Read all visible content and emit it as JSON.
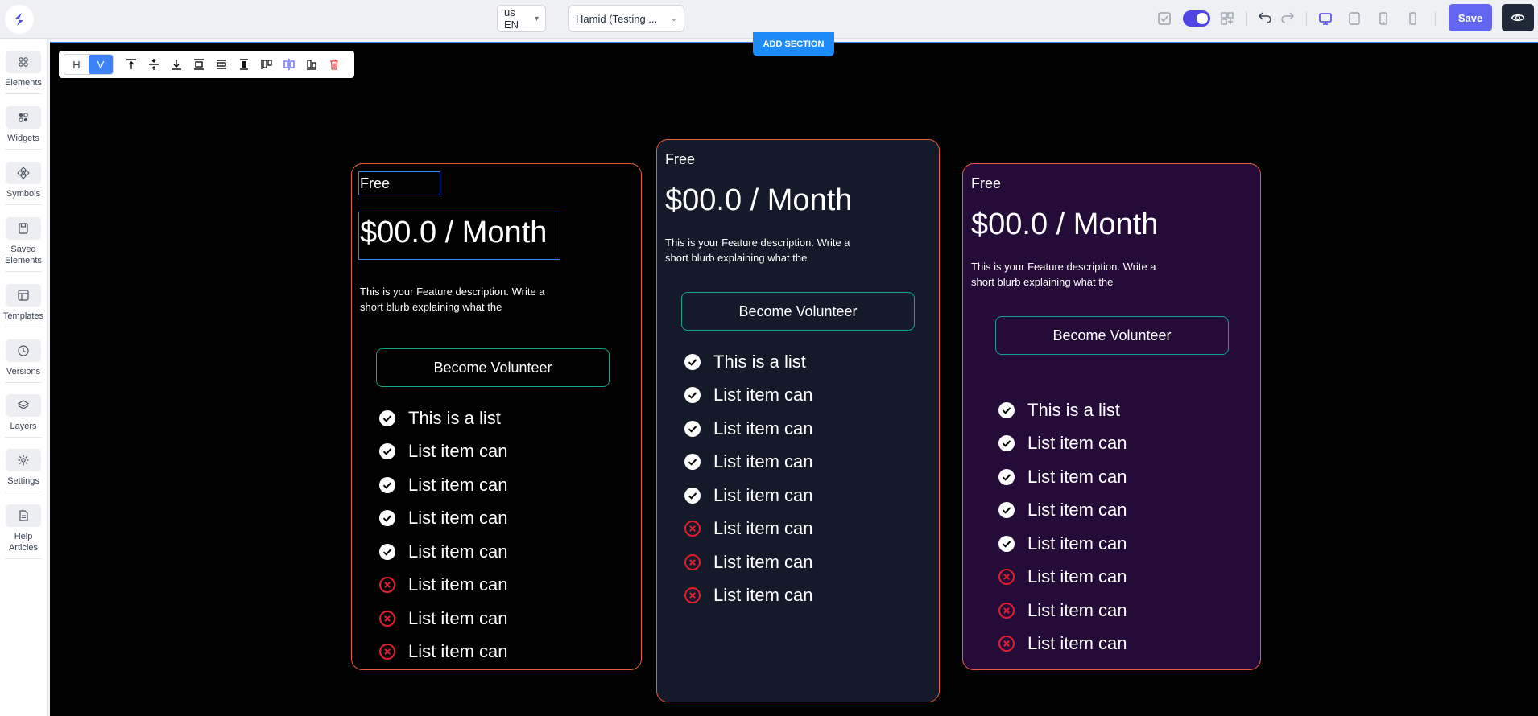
{
  "header": {
    "language": "us EN",
    "user_select": "Hamid (Testing ...",
    "save_label": "Save"
  },
  "add_section_label": "ADD SECTION",
  "toolbar": {
    "h_label": "H",
    "v_label": "V"
  },
  "sidebar": {
    "items": [
      {
        "label": "Elements",
        "icon": "elements-icon"
      },
      {
        "label": "Widgets",
        "icon": "widgets-icon"
      },
      {
        "label": "Symbols",
        "icon": "symbols-icon"
      },
      {
        "label": "Saved Elements",
        "icon": "saved-elements-icon"
      },
      {
        "label": "Templates",
        "icon": "templates-icon"
      },
      {
        "label": "Versions",
        "icon": "versions-icon"
      },
      {
        "label": "Layers",
        "icon": "layers-icon"
      },
      {
        "label": "Settings",
        "icon": "settings-icon"
      },
      {
        "label": "Help Articles",
        "icon": "help-articles-icon"
      }
    ]
  },
  "cards": [
    {
      "plan": "Free",
      "price": "$00.0 / Month",
      "description": "This is your Feature description. Write a short blurb explaining what the",
      "cta": "Become Volunteer",
      "background": "#000000",
      "list": [
        {
          "text": "This is a list",
          "included": true
        },
        {
          "text": "List item can",
          "included": true
        },
        {
          "text": "List item can",
          "included": true
        },
        {
          "text": "List item can",
          "included": true
        },
        {
          "text": "List item can",
          "included": true
        },
        {
          "text": "List item can",
          "included": false
        },
        {
          "text": "List item can",
          "included": false
        },
        {
          "text": "List item can",
          "included": false
        }
      ]
    },
    {
      "plan": "Free",
      "price": "$00.0 / Month",
      "description": "This is your Feature description. Write a short blurb explaining what the",
      "cta": "Become Volunteer",
      "background": "#151a2b",
      "list": [
        {
          "text": "This is a list",
          "included": true
        },
        {
          "text": "List item can",
          "included": true
        },
        {
          "text": "List item can",
          "included": true
        },
        {
          "text": "List item can",
          "included": true
        },
        {
          "text": "List item can",
          "included": true
        },
        {
          "text": "List item can",
          "included": false
        },
        {
          "text": "List item can",
          "included": false
        },
        {
          "text": "List item can",
          "included": false
        }
      ]
    },
    {
      "plan": "Free",
      "price": "$00.0 / Month",
      "description": "This is your Feature description. Write a short blurb explaining what the",
      "cta": "Become Volunteer",
      "background": "#250b38",
      "list": [
        {
          "text": "This is a list",
          "included": true
        },
        {
          "text": "List item can",
          "included": true
        },
        {
          "text": "List item can",
          "included": true
        },
        {
          "text": "List item can",
          "included": true
        },
        {
          "text": "List item can",
          "included": true
        },
        {
          "text": "List item can",
          "included": false
        },
        {
          "text": "List item can",
          "included": false
        },
        {
          "text": "List item can",
          "included": false
        }
      ]
    }
  ],
  "colors": {
    "accent": "#6366f1",
    "border": "#ea5a3c",
    "cta_border": "#15a28c",
    "cross": "#e11d2e"
  }
}
